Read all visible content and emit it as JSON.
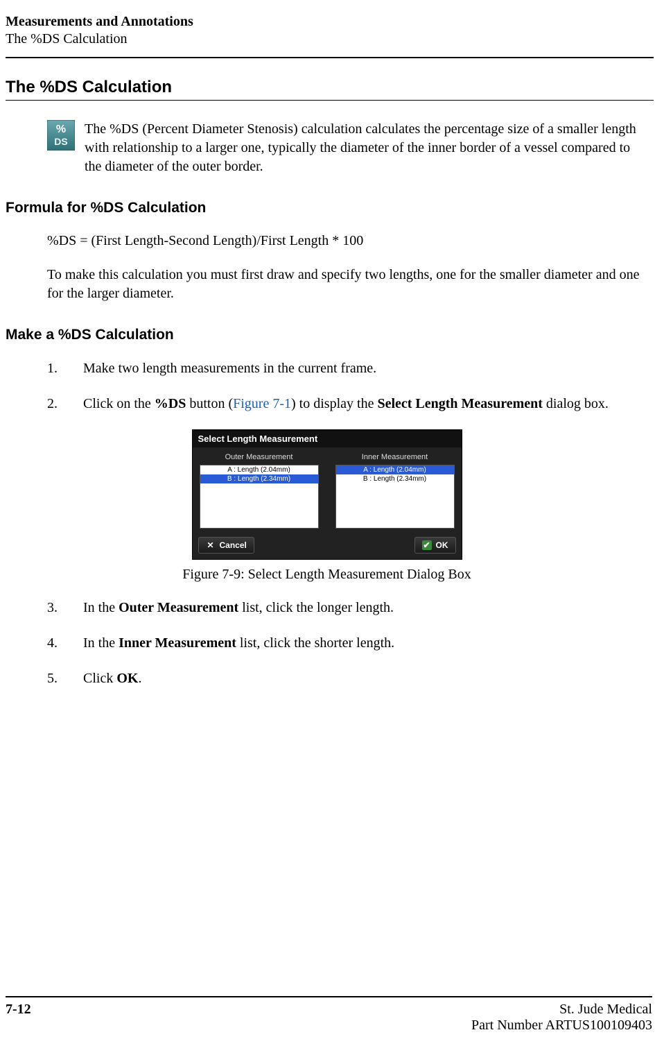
{
  "header": {
    "line1": "Measurements and Annotations",
    "line2": "The %DS Calculation"
  },
  "section_title": "The %DS Calculation",
  "ds_icon": {
    "name": "percent-ds-icon",
    "top_text": "%",
    "bottom_text": "DS",
    "bg_gradient_top": "#6aa9b0",
    "bg_gradient_bottom": "#2f6f76",
    "text_color": "#ffffff"
  },
  "intro_paragraph": "The %DS (Percent Diameter Stenosis) calculation calculates the percentage size of a smaller length with relationship to a larger one, typically the diameter of the inner border of a vessel compared to the diameter of the outer border.",
  "formula_section": {
    "title": "Formula for %DS Calculation",
    "formula": "%DS = (First Length-Second Length)/First Length * 100",
    "note": "To make this calculation you must first draw and specify two lengths, one for the smaller diameter and one for the larger diameter."
  },
  "make_section": {
    "title": "Make a %DS Calculation",
    "steps": [
      {
        "num": "1.",
        "text_plain": "Make two length measurements in the current frame."
      },
      {
        "num": "2.",
        "prefix": "Click on the ",
        "bold1": "%DS",
        "mid1": " button (",
        "figref": "Figure 7-1",
        "mid2": ") to display the ",
        "bold2": "Select Length Measurement",
        "suffix": " dialog box."
      }
    ]
  },
  "dialog": {
    "title": "Select Length Measurement",
    "outer_label": "Outer Measurement",
    "inner_label": "Inner Measurement",
    "outer_options": [
      {
        "label": "A : Length (2.04mm)",
        "selected": false
      },
      {
        "label": "B : Length (2.34mm)",
        "selected": true
      }
    ],
    "inner_options": [
      {
        "label": "A : Length (2.04mm)",
        "selected": true
      },
      {
        "label": "B : Length (2.34mm)",
        "selected": false
      }
    ],
    "cancel_label": "Cancel",
    "ok_label": "OK"
  },
  "figure_caption": "Figure 7-9:  Select Length Measurement Dialog Box",
  "post_steps": [
    {
      "num": "3.",
      "prefix": "In the ",
      "bold": "Outer Measurement",
      "suffix": " list, click the longer length."
    },
    {
      "num": "4.",
      "prefix": "In the ",
      "bold": "Inner Measurement",
      "suffix": " list, click the shorter length."
    },
    {
      "num": "5.",
      "prefix": "Click ",
      "bold": "OK",
      "suffix": "."
    }
  ],
  "footer": {
    "page_number": "7-12",
    "company": "St. Jude Medical",
    "part_number": "Part Number ARTUS100109403"
  }
}
